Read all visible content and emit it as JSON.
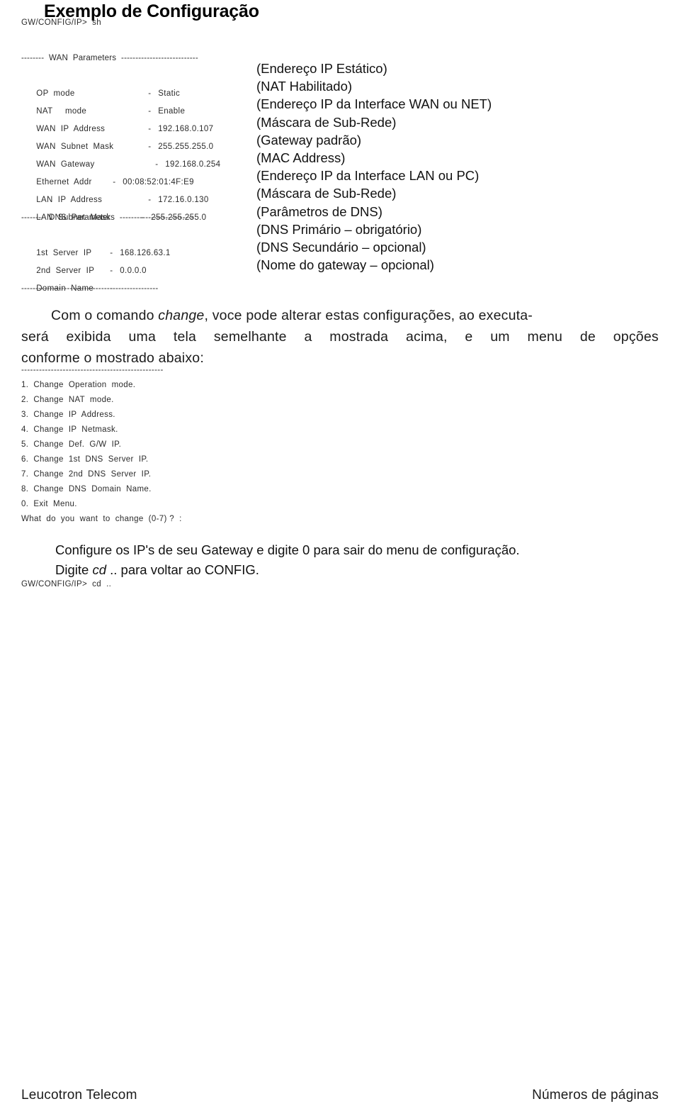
{
  "document": {
    "title": "Exemplo de Configuração"
  },
  "terminal": {
    "prompt_show": "GW/CONFIG/IP>  sh",
    "wan_header": "--------  WAN  Parameters  ---------------------------",
    "dns_header": "--------  DNS  Parameters  --------------------------",
    "bottom_rule": "------------------------------------------------",
    "rows": [
      {
        "key": "OP  mode",
        "dash": "-",
        "value": "Static",
        "annotation": "(Endereço IP Estático)"
      },
      {
        "key": "NAT     mode",
        "dash": "-",
        "value": "Enable",
        "annotation": "(NAT Habilitado)"
      },
      {
        "key": "WAN  IP  Address",
        "dash": "-",
        "value": "192.168.0.107",
        "annotation": "(Endereço IP da Interface WAN ou NET)"
      },
      {
        "key": "WAN  Subnet  Mask",
        "dash": "-",
        "value": "255.255.255.0",
        "annotation": "(Máscara de Sub-Rede)"
      },
      {
        "key": "WAN  Gateway",
        "dash": "-",
        "value": "192.168.0.254",
        "annotation": "(Gateway padrão)"
      },
      {
        "key": "Ethernet  Addr",
        "dash": "-",
        "value": "00:08:52:01:4F:E9",
        "annotation": "(MAC Address)"
      },
      {
        "key": "LAN  IP  Address",
        "dash": "-",
        "value": "172.16.0.130",
        "annotation": "(Endereço IP da Interface LAN ou PC)"
      },
      {
        "key": "LAN  Subnet  Mask",
        "dash": "-",
        "value": "255.255.255.0",
        "annotation": "(Máscara de Sub-Rede)"
      }
    ],
    "dns_rows": [
      {
        "key": "1st  Server  IP",
        "dash": "-",
        "value": "168.126.63.1",
        "annotation": "(DNS Primário – obrigatório)"
      },
      {
        "key": "2nd  Server  IP",
        "dash": "-",
        "value": "0.0.0.0",
        "annotation": "(DNS Secundário – opcional)"
      },
      {
        "key": "Domain  Name",
        "dash": "-",
        "value": "",
        "annotation": "(Nome do gateway – opcional)"
      }
    ],
    "dns_header_annotation": "(Parâmetros de DNS)"
  },
  "body_paragraph": {
    "line1_a": "Com o comando ",
    "line1_italic": "change",
    "line1_b": ", voce pode alterar estas configurações, ao executa-",
    "line2_words": [
      "será",
      "exibida",
      "uma",
      "tela",
      "semelhante",
      "a",
      "mostrada",
      "acima,",
      "e",
      "um",
      "menu",
      "de",
      "opções"
    ],
    "line3": "conforme o mostrado abaixo:"
  },
  "menu": {
    "top_rule": "------------------------------------------------",
    "items": [
      "1.  Change  Operation  mode.",
      "2.  Change  NAT  mode.",
      "3.  Change  IP  Address.",
      "4.  Change  IP  Netmask.",
      "5.  Change  Def.  G/W  IP.",
      "6.  Change  1st  DNS  Server  IP.",
      "7.  Change  2nd  DNS  Server  IP.",
      "8.  Change  DNS  Domain  Name.",
      "0.  Exit  Menu."
    ],
    "question": "What  do  you  want  to  change  (0-7) ?  :"
  },
  "closing": {
    "line1": "Configure os IP's de seu Gateway e digite 0 para sair do menu de configuração.",
    "line2_a": "Digite ",
    "line2_italic": "cd",
    "line2_b": " .. para voltar ao CONFIG.",
    "prompt": "GW/CONFIG/IP>  cd  .."
  },
  "footer": {
    "left": "Leucotron Telecom",
    "right": "Números de páginas"
  }
}
